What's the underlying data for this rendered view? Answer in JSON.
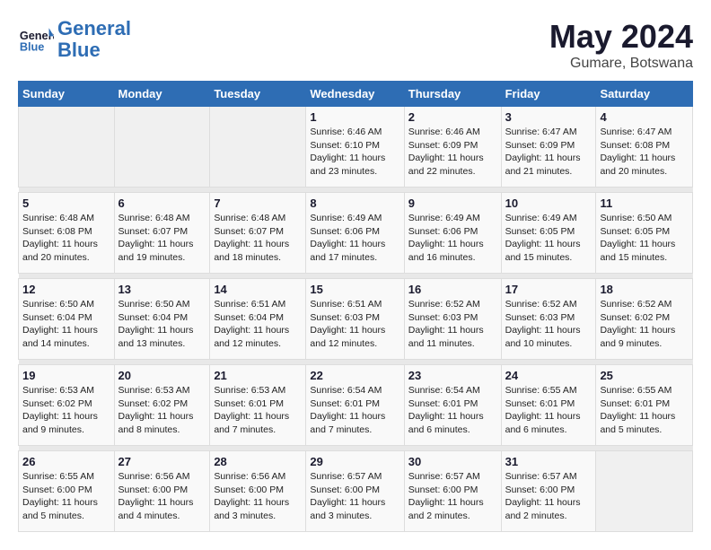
{
  "logo": {
    "line1": "General",
    "line2": "Blue"
  },
  "title": "May 2024",
  "subtitle": "Gumare, Botswana",
  "days_header": [
    "Sunday",
    "Monday",
    "Tuesday",
    "Wednesday",
    "Thursday",
    "Friday",
    "Saturday"
  ],
  "weeks": [
    [
      {
        "day": "",
        "info": ""
      },
      {
        "day": "",
        "info": ""
      },
      {
        "day": "",
        "info": ""
      },
      {
        "day": "1",
        "info": "Sunrise: 6:46 AM\nSunset: 6:10 PM\nDaylight: 11 hours\nand 23 minutes."
      },
      {
        "day": "2",
        "info": "Sunrise: 6:46 AM\nSunset: 6:09 PM\nDaylight: 11 hours\nand 22 minutes."
      },
      {
        "day": "3",
        "info": "Sunrise: 6:47 AM\nSunset: 6:09 PM\nDaylight: 11 hours\nand 21 minutes."
      },
      {
        "day": "4",
        "info": "Sunrise: 6:47 AM\nSunset: 6:08 PM\nDaylight: 11 hours\nand 20 minutes."
      }
    ],
    [
      {
        "day": "5",
        "info": "Sunrise: 6:48 AM\nSunset: 6:08 PM\nDaylight: 11 hours\nand 20 minutes."
      },
      {
        "day": "6",
        "info": "Sunrise: 6:48 AM\nSunset: 6:07 PM\nDaylight: 11 hours\nand 19 minutes."
      },
      {
        "day": "7",
        "info": "Sunrise: 6:48 AM\nSunset: 6:07 PM\nDaylight: 11 hours\nand 18 minutes."
      },
      {
        "day": "8",
        "info": "Sunrise: 6:49 AM\nSunset: 6:06 PM\nDaylight: 11 hours\nand 17 minutes."
      },
      {
        "day": "9",
        "info": "Sunrise: 6:49 AM\nSunset: 6:06 PM\nDaylight: 11 hours\nand 16 minutes."
      },
      {
        "day": "10",
        "info": "Sunrise: 6:49 AM\nSunset: 6:05 PM\nDaylight: 11 hours\nand 15 minutes."
      },
      {
        "day": "11",
        "info": "Sunrise: 6:50 AM\nSunset: 6:05 PM\nDaylight: 11 hours\nand 15 minutes."
      }
    ],
    [
      {
        "day": "12",
        "info": "Sunrise: 6:50 AM\nSunset: 6:04 PM\nDaylight: 11 hours\nand 14 minutes."
      },
      {
        "day": "13",
        "info": "Sunrise: 6:50 AM\nSunset: 6:04 PM\nDaylight: 11 hours\nand 13 minutes."
      },
      {
        "day": "14",
        "info": "Sunrise: 6:51 AM\nSunset: 6:04 PM\nDaylight: 11 hours\nand 12 minutes."
      },
      {
        "day": "15",
        "info": "Sunrise: 6:51 AM\nSunset: 6:03 PM\nDaylight: 11 hours\nand 12 minutes."
      },
      {
        "day": "16",
        "info": "Sunrise: 6:52 AM\nSunset: 6:03 PM\nDaylight: 11 hours\nand 11 minutes."
      },
      {
        "day": "17",
        "info": "Sunrise: 6:52 AM\nSunset: 6:03 PM\nDaylight: 11 hours\nand 10 minutes."
      },
      {
        "day": "18",
        "info": "Sunrise: 6:52 AM\nSunset: 6:02 PM\nDaylight: 11 hours\nand 9 minutes."
      }
    ],
    [
      {
        "day": "19",
        "info": "Sunrise: 6:53 AM\nSunset: 6:02 PM\nDaylight: 11 hours\nand 9 minutes."
      },
      {
        "day": "20",
        "info": "Sunrise: 6:53 AM\nSunset: 6:02 PM\nDaylight: 11 hours\nand 8 minutes."
      },
      {
        "day": "21",
        "info": "Sunrise: 6:53 AM\nSunset: 6:01 PM\nDaylight: 11 hours\nand 7 minutes."
      },
      {
        "day": "22",
        "info": "Sunrise: 6:54 AM\nSunset: 6:01 PM\nDaylight: 11 hours\nand 7 minutes."
      },
      {
        "day": "23",
        "info": "Sunrise: 6:54 AM\nSunset: 6:01 PM\nDaylight: 11 hours\nand 6 minutes."
      },
      {
        "day": "24",
        "info": "Sunrise: 6:55 AM\nSunset: 6:01 PM\nDaylight: 11 hours\nand 6 minutes."
      },
      {
        "day": "25",
        "info": "Sunrise: 6:55 AM\nSunset: 6:01 PM\nDaylight: 11 hours\nand 5 minutes."
      }
    ],
    [
      {
        "day": "26",
        "info": "Sunrise: 6:55 AM\nSunset: 6:00 PM\nDaylight: 11 hours\nand 5 minutes."
      },
      {
        "day": "27",
        "info": "Sunrise: 6:56 AM\nSunset: 6:00 PM\nDaylight: 11 hours\nand 4 minutes."
      },
      {
        "day": "28",
        "info": "Sunrise: 6:56 AM\nSunset: 6:00 PM\nDaylight: 11 hours\nand 3 minutes."
      },
      {
        "day": "29",
        "info": "Sunrise: 6:57 AM\nSunset: 6:00 PM\nDaylight: 11 hours\nand 3 minutes."
      },
      {
        "day": "30",
        "info": "Sunrise: 6:57 AM\nSunset: 6:00 PM\nDaylight: 11 hours\nand 2 minutes."
      },
      {
        "day": "31",
        "info": "Sunrise: 6:57 AM\nSunset: 6:00 PM\nDaylight: 11 hours\nand 2 minutes."
      },
      {
        "day": "",
        "info": ""
      }
    ]
  ]
}
